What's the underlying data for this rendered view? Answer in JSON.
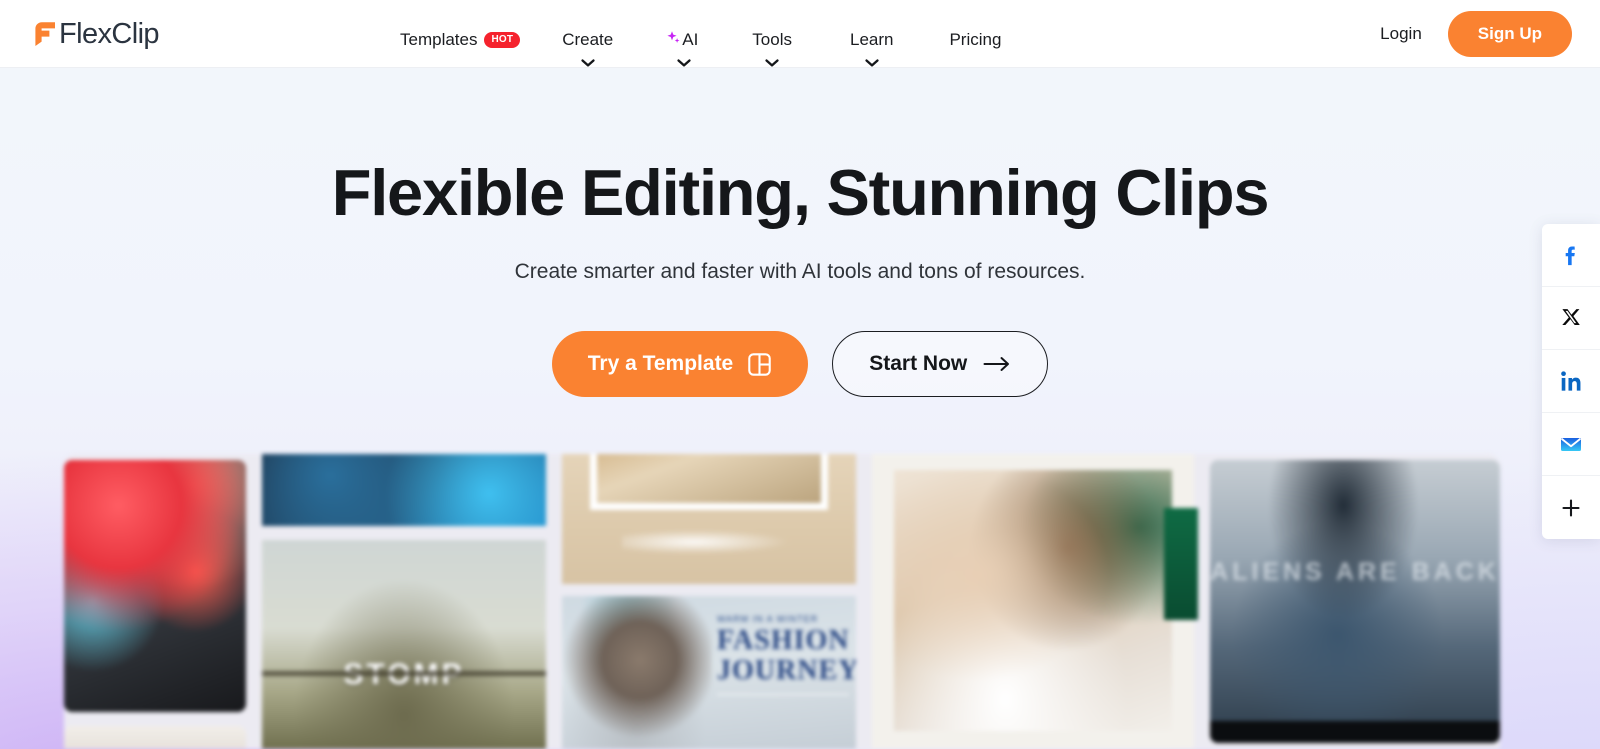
{
  "brand": {
    "name": "FlexClip",
    "logo_icon": "flexclip-f-logo",
    "accent_orange": "#FA8231",
    "badge_red": "#F5222D",
    "ai_purple": "#C724F5"
  },
  "header": {
    "nav_items": [
      {
        "label": "Templates",
        "badge": "HOT",
        "has_caret": false,
        "icon": ""
      },
      {
        "label": "Create",
        "badge": "",
        "has_caret": true,
        "icon": ""
      },
      {
        "label": "AI",
        "badge": "",
        "has_caret": true,
        "icon": "sparkle-icon"
      },
      {
        "label": "Tools",
        "badge": "",
        "has_caret": true,
        "icon": ""
      },
      {
        "label": "Learn",
        "badge": "",
        "has_caret": true,
        "icon": ""
      },
      {
        "label": "Pricing",
        "badge": "",
        "has_caret": false,
        "icon": ""
      }
    ],
    "login_label": "Login",
    "signup_label": "Sign Up"
  },
  "hero": {
    "title": "Flexible Editing, Stunning Clips",
    "subtitle": "Create smarter and faster with AI tools and tons of resources.",
    "primary_cta": {
      "label": "Try a Template",
      "icon": "template-layout-icon"
    },
    "secondary_cta": {
      "label": "Start Now",
      "icon": "arrow-right-icon"
    }
  },
  "gallery": {
    "tiles": [
      {
        "name": "fitness-app-phone",
        "caption": ""
      },
      {
        "name": "ocean-blue-clip",
        "caption": ""
      },
      {
        "name": "stomp-sport-clip",
        "caption": "STOMP"
      },
      {
        "name": "wedding-photo-frame",
        "caption": ""
      },
      {
        "name": "fashion-journey-clip",
        "caption": "FASHION JOURNEY"
      },
      {
        "name": "couple-wedding-clip",
        "caption": ""
      },
      {
        "name": "aliens-are-back-clip",
        "caption": "ALIENS ARE BACK"
      }
    ]
  },
  "social_rail": {
    "items": [
      {
        "name": "facebook-icon",
        "label": "Facebook",
        "color": "#1877F2"
      },
      {
        "name": "x-twitter-icon",
        "label": "X",
        "color": "#000000"
      },
      {
        "name": "linkedin-icon",
        "label": "LinkedIn",
        "color": "#0A66C2"
      },
      {
        "name": "email-icon",
        "label": "Email",
        "color": "#1E88F0"
      },
      {
        "name": "plus-icon",
        "label": "More",
        "color": "#16181C"
      }
    ]
  }
}
